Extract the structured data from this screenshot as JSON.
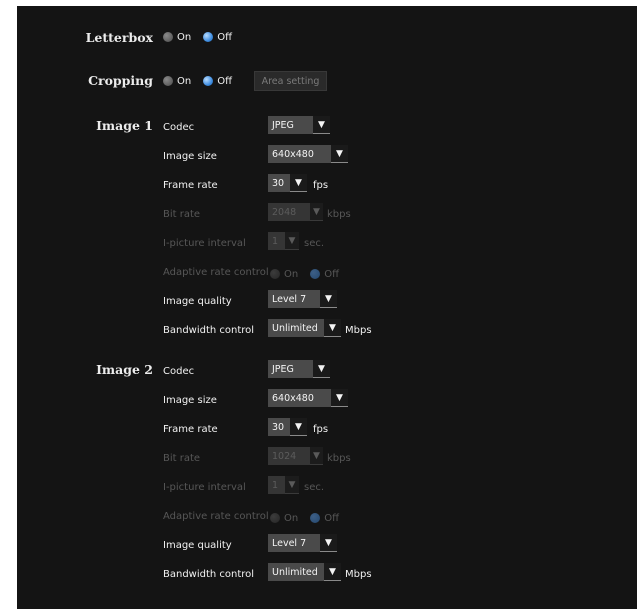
{
  "letterbox": {
    "label": "Letterbox",
    "on": "On",
    "off": "Off"
  },
  "cropping": {
    "label": "Cropping",
    "on": "On",
    "off": "Off",
    "area_button": "Area setting"
  },
  "image1": {
    "title": "Image 1",
    "codec": {
      "label": "Codec",
      "value": "JPEG"
    },
    "image_size": {
      "label": "Image size",
      "value": "640x480"
    },
    "frame_rate": {
      "label": "Frame rate",
      "value": "30",
      "unit": "fps"
    },
    "bit_rate": {
      "label": "Bit rate",
      "value": "2048",
      "unit": "kbps"
    },
    "i_picture": {
      "label": "I-picture interval",
      "value": "1",
      "unit": "sec."
    },
    "adaptive": {
      "label": "Adaptive rate control",
      "on": "On",
      "off": "Off"
    },
    "quality": {
      "label": "Image quality",
      "value": "Level 7"
    },
    "bandwidth": {
      "label": "Bandwidth control",
      "value": "Unlimited",
      "unit": "Mbps"
    }
  },
  "image2": {
    "title": "Image 2",
    "codec": {
      "label": "Codec",
      "value": "JPEG"
    },
    "image_size": {
      "label": "Image size",
      "value": "640x480"
    },
    "frame_rate": {
      "label": "Frame rate",
      "value": "30",
      "unit": "fps"
    },
    "bit_rate": {
      "label": "Bit rate",
      "value": "1024",
      "unit": "kbps"
    },
    "i_picture": {
      "label": "I-picture interval",
      "value": "1",
      "unit": "sec."
    },
    "adaptive": {
      "label": "Adaptive rate control",
      "on": "On",
      "off": "Off"
    },
    "quality": {
      "label": "Image quality",
      "value": "Level 7"
    },
    "bandwidth": {
      "label": "Bandwidth control",
      "value": "Unlimited",
      "unit": "Mbps"
    }
  },
  "colors": {
    "panel": "#141414",
    "select_bg": "#4a4a4a",
    "radio_selected": "#3f8de0",
    "disabled_text": "#575757"
  },
  "icons": {
    "dropdown": "chevron-down-icon",
    "radio": "radio-icon"
  }
}
